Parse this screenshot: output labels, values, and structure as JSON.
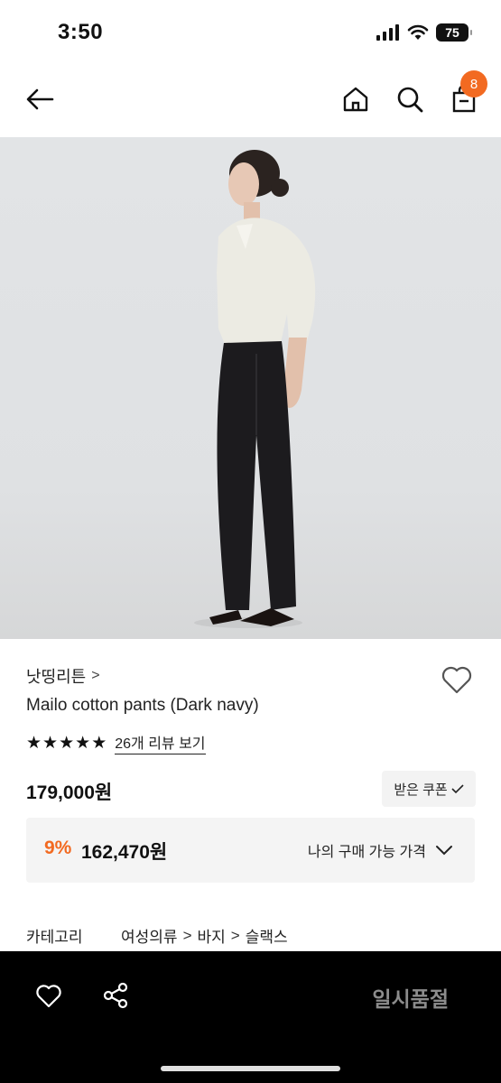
{
  "status_bar": {
    "time": "3:50",
    "battery": "75",
    "icons": [
      "signal-icon",
      "wifi-icon",
      "battery-icon"
    ]
  },
  "nav": {
    "icons": [
      "back-arrow-icon",
      "home-icon",
      "search-icon",
      "shopping-bag-icon"
    ],
    "cart_count": "8"
  },
  "product": {
    "image_alt": "",
    "brand": "낫띵리튼",
    "brand_chevron": ">",
    "name": "Mailo cotton pants (Dark navy)",
    "rating_stars": 5,
    "review_link": "26개 리뷰 보기",
    "price_original": "179,000원",
    "coupon_button": "받은 쿠폰",
    "discount_rate": "9%",
    "discount_price": "162,470원",
    "my_price_label": "나의 구매 가능 가격"
  },
  "category": {
    "label": "카테고리",
    "path": [
      "여성의류",
      "바지",
      "슬랙스"
    ],
    "separator": ">"
  },
  "bottom_bar": {
    "soldout_label": "일시품절"
  },
  "colors": {
    "accent": "#f26a21",
    "bottom_bar_bg": "#000000",
    "soldout_text": "#8c8c8c"
  }
}
